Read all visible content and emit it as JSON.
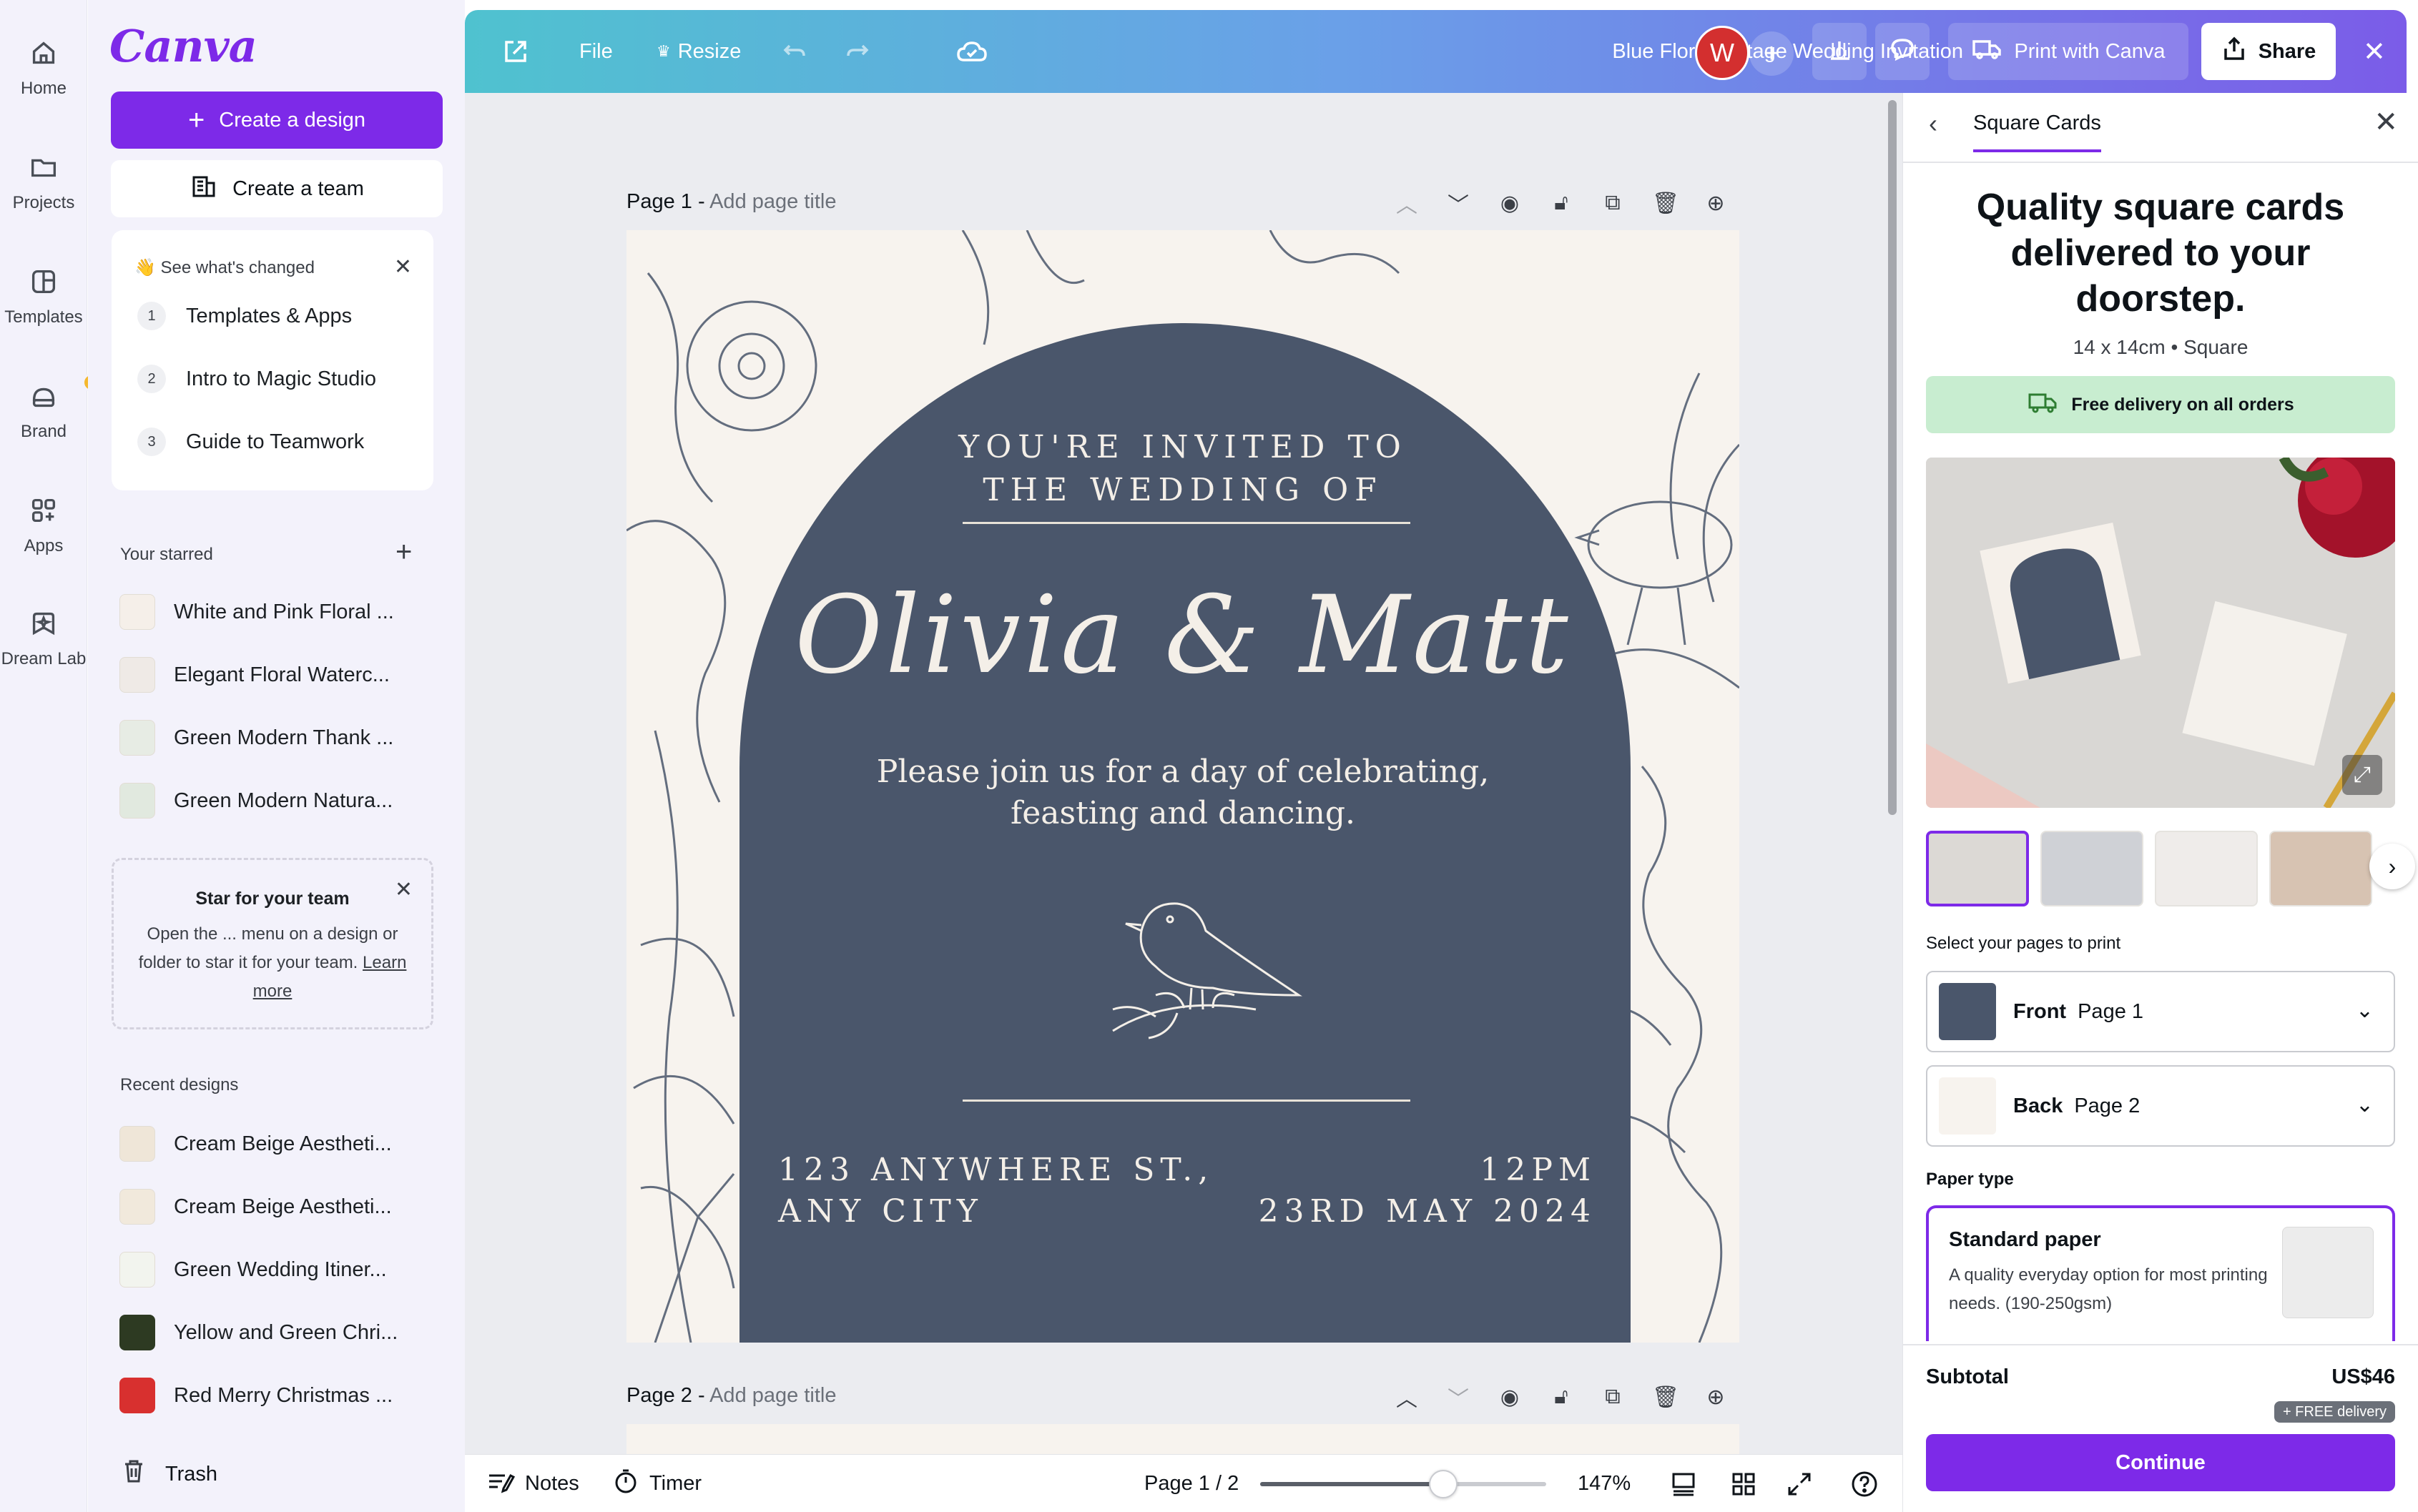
{
  "rail": {
    "items": [
      {
        "label": "Home",
        "icon": "home-icon"
      },
      {
        "label": "Projects",
        "icon": "folder-icon"
      },
      {
        "label": "Templates",
        "icon": "templates-icon"
      },
      {
        "label": "Brand",
        "icon": "brand-icon"
      },
      {
        "label": "Apps",
        "icon": "apps-icon"
      },
      {
        "label": "Dream Lab",
        "icon": "dream-lab-icon"
      }
    ]
  },
  "side": {
    "logo": "Canva",
    "create_design": "Create a design",
    "create_team": "Create a team",
    "changes_title": "👋 See what's changed",
    "steps": [
      {
        "num": "1",
        "label": "Templates & Apps"
      },
      {
        "num": "2",
        "label": "Intro to Magic Studio"
      },
      {
        "num": "3",
        "label": "Guide to Teamwork"
      }
    ],
    "starred_label": "Your starred",
    "starred": [
      "White and Pink Floral ...",
      "Elegant Floral Waterc...",
      "Green Modern Thank ...",
      "Green Modern Natura..."
    ],
    "star_card_title": "Star for your team",
    "star_card_body": "Open the ... menu on a design or folder to star it for your team.",
    "star_card_link": "Learn more",
    "recent_label": "Recent designs",
    "recent": [
      "Cream Beige Aestheti...",
      "Cream Beige Aestheti...",
      "Green Wedding Itiner...",
      "Yellow and Green Chri...",
      "Red Merry Christmas ..."
    ],
    "trash": "Trash"
  },
  "topbar": {
    "file": "File",
    "resize": "Resize",
    "title": "Blue Floral Vintage Wedding Invitation",
    "avatar": "W",
    "print": "Print with Canva",
    "share": "Share"
  },
  "canvas": {
    "page1_label": "Page 1 - ",
    "page1_sub": "Add page title",
    "page2_label": "Page 2 - ",
    "page2_sub": "Add page title",
    "invite_line1": "YOU'RE INVITED TO",
    "invite_line2": "THE WEDDING OF",
    "names": "Olivia & Matt",
    "body_line1": "Please join us for a day of celebrating,",
    "body_line2": "feasting and dancing.",
    "addr_line1": "123 ANYWHERE ST.,",
    "addr_line2": "ANY CITY",
    "time": "12PM",
    "date": "23RD MAY 2024"
  },
  "bottombar": {
    "notes": "Notes",
    "timer": "Timer",
    "page_indicator": "Page 1 / 2",
    "zoom_fraction": 0.64,
    "zoom": "147%"
  },
  "rpanel": {
    "tab": "Square Cards",
    "heading": "Quality square cards delivered to your doorstep.",
    "size": "14 x 14cm • Square",
    "free_delivery": "Free delivery on all orders",
    "select_pages_label": "Select your pages to print",
    "front_label": "Front",
    "front_page": "Page 1",
    "back_label": "Back",
    "back_page": "Page 2",
    "paper_type_label": "Paper type",
    "paper_title": "Standard paper",
    "paper_desc": "A quality everyday option for most printing needs. (190-250gsm)",
    "subtotal_label": "Subtotal",
    "subtotal_value": "US$46",
    "free_delivery_badge": "+ FREE delivery",
    "continue": "Continue"
  },
  "colors": {
    "accent": "#7d2ae8",
    "arch": "#4a566b",
    "paper": "#f7f3ee"
  }
}
